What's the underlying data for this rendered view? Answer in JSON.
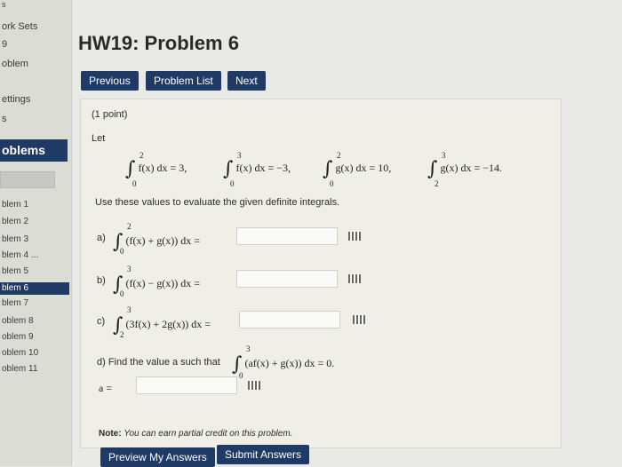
{
  "sidebar": {
    "top_marker": "s",
    "work_sets": "ork Sets",
    "set_number": "9",
    "problem_label": "oblem",
    "settings_label": "ettings",
    "marker_b": "s",
    "problems_header": "oblems",
    "items": [
      "blem 1",
      "blem 2",
      "blem 3",
      "blem 4 ...",
      "blem 5",
      "blem 6",
      "blem 7",
      "oblem 8",
      "oblem 9",
      "oblem 10",
      "oblem 11"
    ]
  },
  "title": "HW19: Problem 6",
  "nav": {
    "previous": "Previous",
    "problem_list": "Problem List",
    "next": "Next"
  },
  "problem": {
    "points": "(1 point)",
    "let": "Let",
    "given": [
      {
        "integrand": "f(x) dx = 3,",
        "lower": "0",
        "upper": "2"
      },
      {
        "integrand": "f(x) dx = −3,",
        "lower": "0",
        "upper": "3"
      },
      {
        "integrand": "g(x) dx = 10,",
        "lower": "0",
        "upper": "2"
      },
      {
        "integrand": "g(x) dx = −14.",
        "lower": "2",
        "upper": "3"
      }
    ],
    "instruction": "Use these values to evaluate the given definite integrals.",
    "parts": [
      {
        "label": "a)",
        "expr": "(f(x) + g(x)) dx =",
        "lower": "0",
        "upper": "2",
        "value": ""
      },
      {
        "label": "b)",
        "expr": "(f(x) − g(x)) dx =",
        "lower": "0",
        "upper": "3",
        "value": ""
      },
      {
        "label": "c)",
        "expr": "(3f(x) + 2g(x)) dx =",
        "lower": "2",
        "upper": "3",
        "value": ""
      }
    ],
    "part_d": {
      "text": "d) Find the value a such that",
      "expr": "(af(x) + g(x)) dx = 0.",
      "lower": "0",
      "upper": "3",
      "var_label": "a =",
      "value": ""
    },
    "note_bold": "Note:",
    "note_text": "You can earn partial credit on this problem."
  },
  "buttons": {
    "preview": "Preview My Answers",
    "submit": "Submit Answers"
  },
  "colors": {
    "accent": "#1f3a64",
    "panel": "#efefe8",
    "background": "#e9e9e5"
  }
}
